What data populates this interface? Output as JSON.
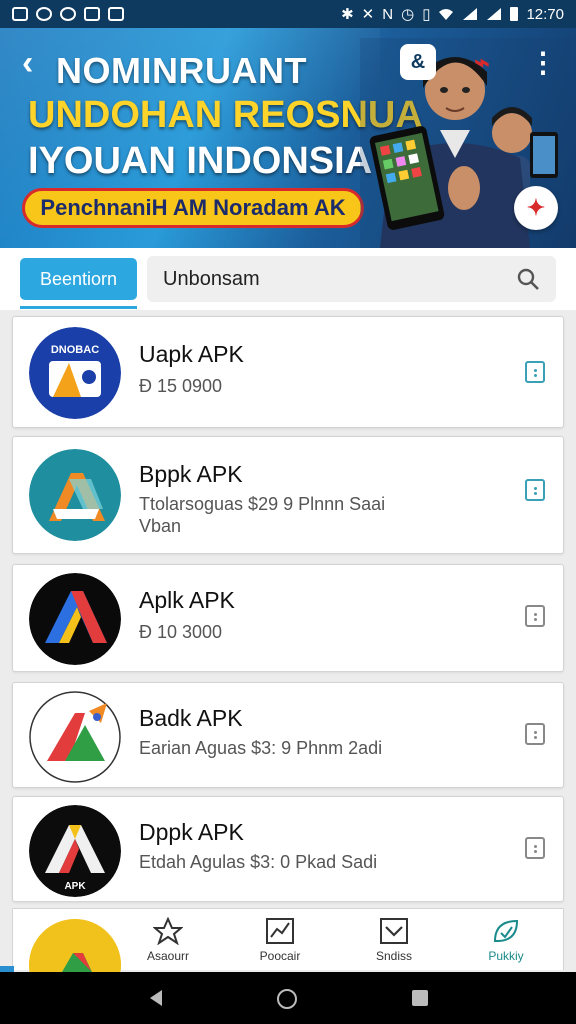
{
  "status_bar": {
    "time": "12:70"
  },
  "banner": {
    "title": "NOMINRUANT",
    "line1": "UNDOHAN REOSNUA",
    "line2": "IYOUAN INDONSIA",
    "pill": "PenchnaniH AM Noradam AK",
    "action_a": "&"
  },
  "tabs": {
    "active_label": "Beentiorn"
  },
  "search": {
    "value": "Unbonsam"
  },
  "apps": [
    {
      "title": "Uapk APK",
      "subtitle": "Đ 15 0900"
    },
    {
      "title": "Bppk APK",
      "subtitle": "Ttolarsoguas $29 9 Plnnn Saai Vban"
    },
    {
      "title": "Aplk APK",
      "subtitle": "Đ 10 3000"
    },
    {
      "title": "Badk APK",
      "subtitle": "Earian Aguas $3: 9 Phnm 2adi"
    },
    {
      "title": "Dppk APK",
      "subtitle": "Etdah Agulas $3: 0 Pkad Sadi"
    }
  ],
  "logo_text": {
    "app1": "DNOBAC",
    "app5": "APK"
  },
  "bottom_nav": [
    {
      "label": "Asaourr"
    },
    {
      "label": "Poocair"
    },
    {
      "label": "Sndiss"
    },
    {
      "label": "Pukkiy"
    }
  ],
  "colors": {
    "accent": "#2da7df",
    "banner": "#1c7bbf",
    "pill": "#f7c619",
    "active_nav": "#1b8a8a"
  }
}
